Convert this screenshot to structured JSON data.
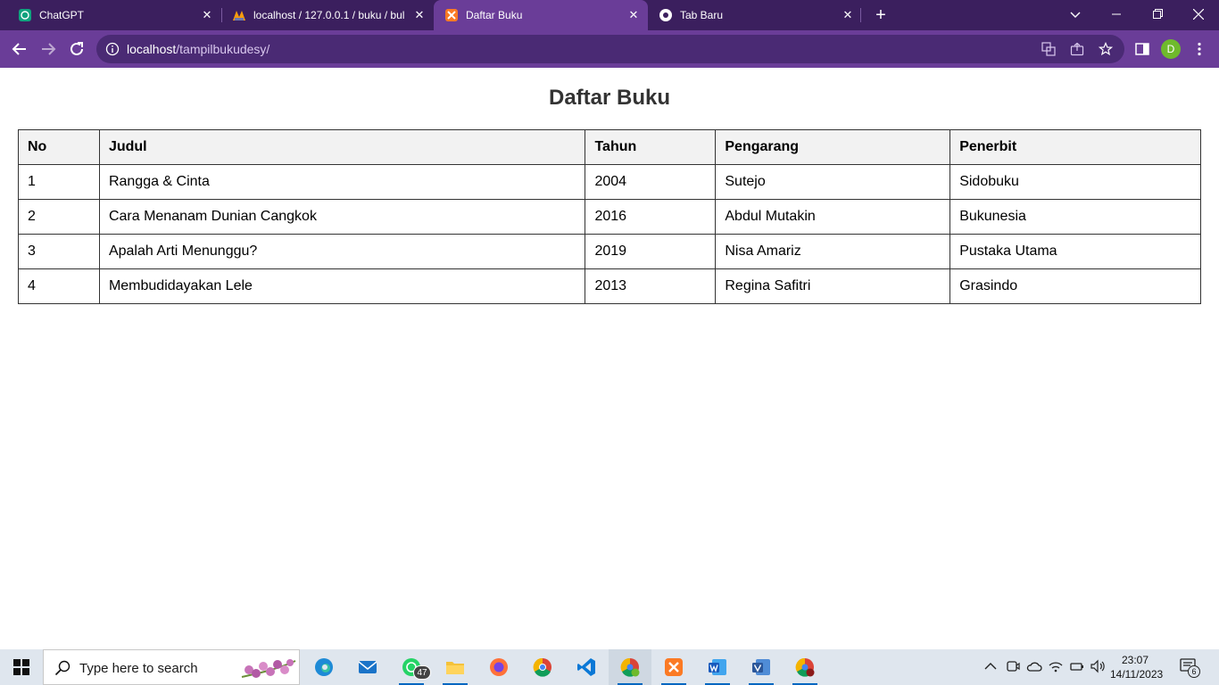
{
  "browser": {
    "tabs": [
      {
        "title": "ChatGPT",
        "active": false
      },
      {
        "title": "localhost / 127.0.0.1 / buku / bul",
        "active": false
      },
      {
        "title": "Daftar Buku",
        "active": true
      },
      {
        "title": "Tab Baru",
        "active": false
      }
    ],
    "url_host": "localhost",
    "url_path": "/tampilbukudesy/",
    "profile_initial": "D",
    "accent": "#6a3d98"
  },
  "page": {
    "title": "Daftar Buku",
    "table": {
      "headers": [
        "No",
        "Judul",
        "Tahun",
        "Pengarang",
        "Penerbit"
      ],
      "rows": [
        [
          "1",
          "Rangga & Cinta",
          "2004",
          "Sutejo",
          "Sidobuku"
        ],
        [
          "2",
          "Cara Menanam Dunian Cangkok",
          "2016",
          "Abdul Mutakin",
          "Bukunesia"
        ],
        [
          "3",
          "Apalah Arti Menunggu?",
          "2019",
          "Nisa Amariz",
          "Pustaka Utama"
        ],
        [
          "4",
          "Membudidayakan Lele",
          "2013",
          "Regina Safitri",
          "Grasindo"
        ]
      ]
    }
  },
  "taskbar": {
    "search_placeholder": "Type here to search",
    "whatsapp_badge": "47",
    "time": "23:07",
    "date": "14/11/2023",
    "notification_count": "6"
  }
}
